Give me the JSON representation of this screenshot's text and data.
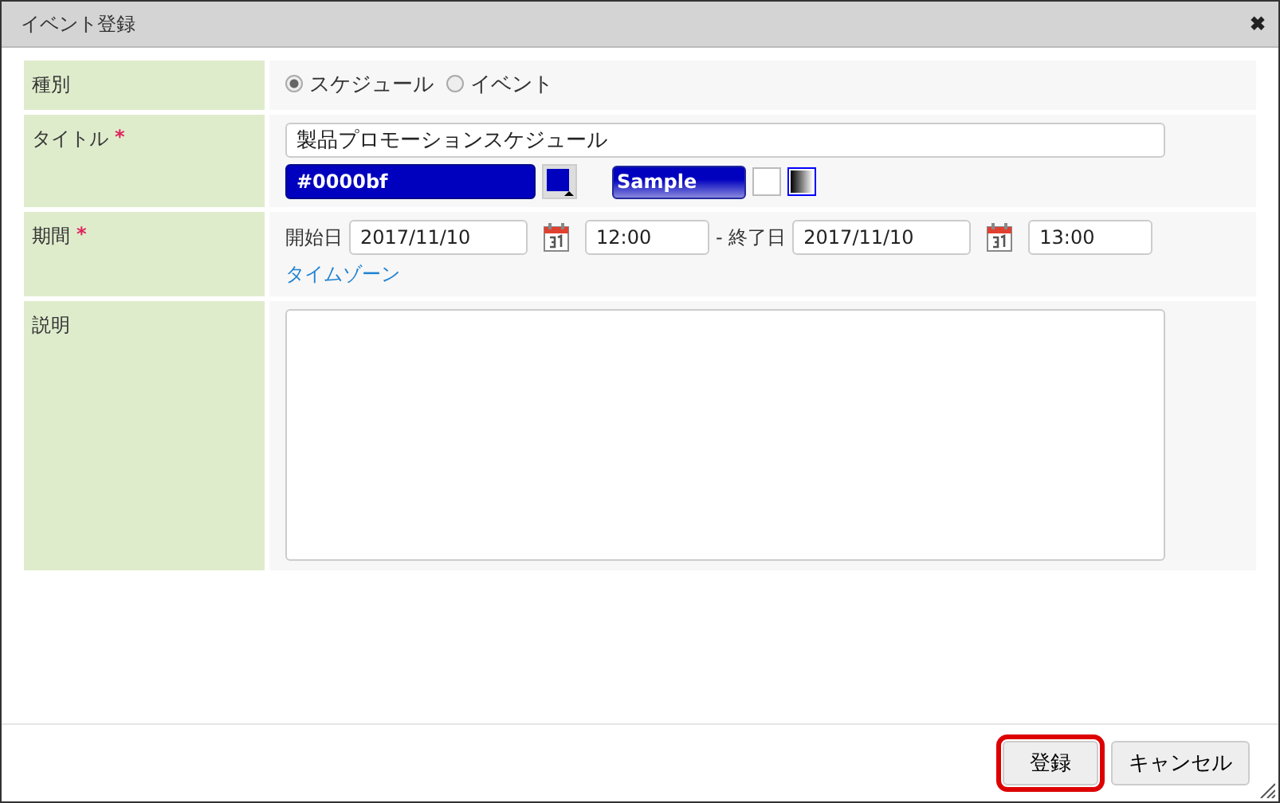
{
  "window": {
    "title": "イベント登録",
    "close": "✖"
  },
  "type_row": {
    "label": "種別",
    "options": [
      {
        "label": "スケジュール",
        "selected": true
      },
      {
        "label": "イベント",
        "selected": false
      }
    ]
  },
  "title_row": {
    "label": "タイトル",
    "required": "*",
    "value": "製品プロモーションスケジュール",
    "color_value": "#0000bf",
    "color": "#0000bf",
    "sample": "Sample",
    "gradients": [
      {
        "kind": "plain",
        "selected": false
      },
      {
        "kind": "gradient",
        "selected": true
      }
    ]
  },
  "period_row": {
    "label": "期間",
    "required": "*",
    "start_label": "開始日",
    "start_date": "2017/11/10",
    "start_time": "12:00",
    "end_label": "- 終了日",
    "end_date": "2017/11/10",
    "end_time": "13:00",
    "timezone_link": "タイムゾーン"
  },
  "description_row": {
    "label": "説明"
  },
  "buttons": [
    {
      "label": "登録",
      "focused": true
    },
    {
      "label": "キャンセル",
      "focused": false
    }
  ]
}
